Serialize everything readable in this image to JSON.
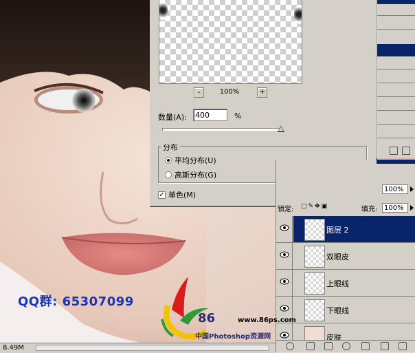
{
  "dialog": {
    "zoom_out_label": "-",
    "zoom_in_label": "+",
    "zoom_level": "100%",
    "amount_label": "数量(A):",
    "amount_value": "400",
    "amount_unit": "%",
    "amount_slider_level_percent": 400,
    "distribution_title": "分布",
    "distribution_options": [
      {
        "label": "平均分布(U)",
        "selected": true
      },
      {
        "label": "高斯分布(G)",
        "selected": false
      }
    ],
    "monochrome_label": "单色(M)",
    "monochrome_checked": true
  },
  "layers": {
    "opacity_value": "100%",
    "lock_label": "锁定:",
    "fill_label": "填充:",
    "fill_value": "100%",
    "items": [
      {
        "name": "图层 2",
        "selected": true
      },
      {
        "name": "双眼皮",
        "selected": false
      },
      {
        "name": "上眼线",
        "selected": false
      },
      {
        "name": "下眼线",
        "selected": false
      },
      {
        "name": "皮肤",
        "selected": false
      }
    ]
  },
  "overlay": {
    "qq_text": "QQ群: 65307099",
    "logo_number": "86",
    "logo_url": "www.86ps.com",
    "logo_cn": "中国Photoshop资源网"
  },
  "status": {
    "doc_size": "8.49M"
  },
  "colors": {
    "dialog_bg": "#d4d0c8",
    "selection_blue": "#0a246a",
    "qq_text_blue": "#1a36b4"
  }
}
